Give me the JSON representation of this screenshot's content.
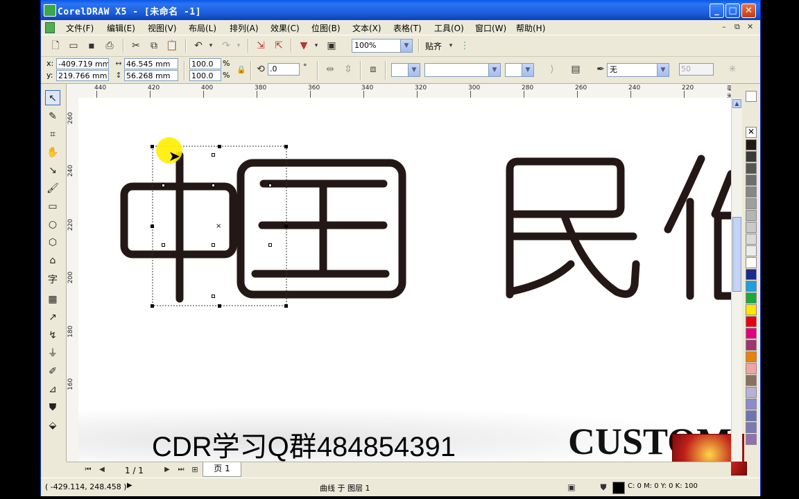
{
  "window": {
    "title": "CorelDRAW X5 - [未命名 -1]"
  },
  "menu": [
    "文件(F)",
    "编辑(E)",
    "视图(V)",
    "布局(L)",
    "排列(A)",
    "效果(C)",
    "位图(B)",
    "文本(X)",
    "表格(T)",
    "工具(O)",
    "窗口(W)",
    "帮助(H)"
  ],
  "toolbar": {
    "zoom": "100%",
    "snap_label": "贴齐"
  },
  "property_bar": {
    "x": "-409.719 mm",
    "y": "219.766 mm",
    "width": "46.545 mm",
    "height": "56.268 mm",
    "scale_w": "100.0",
    "scale_h": "100.0",
    "pct": "%",
    "angle": ".0",
    "deg": "°",
    "outline": "无",
    "miter": "50",
    "x_label": "x:",
    "y_label": "y:"
  },
  "ruler_h": [
    "440",
    "420",
    "400",
    "380",
    "360",
    "340",
    "320",
    "300",
    "280",
    "260",
    "240",
    "220"
  ],
  "ruler_h_unit": "毫米",
  "ruler_v": [
    "260",
    "240",
    "220",
    "200",
    "180",
    "160"
  ],
  "canvas": {
    "glyphs": [
      "中",
      "国",
      "民",
      "俗"
    ]
  },
  "overlay": {
    "watermark": "CDR学习Q群484854391",
    "custom_text": "CUSTOM"
  },
  "page_nav": {
    "count": "1 / 1",
    "page_tab": "页 1"
  },
  "status": {
    "coords": "( -429.114, 248.458 )",
    "object_info": "曲线 于 图层 1",
    "fill_info": "C: 0 M: 0 Y: 0 K: 100"
  },
  "colors": {
    "title_blue": "#0a58e8",
    "selection": "#000000"
  }
}
